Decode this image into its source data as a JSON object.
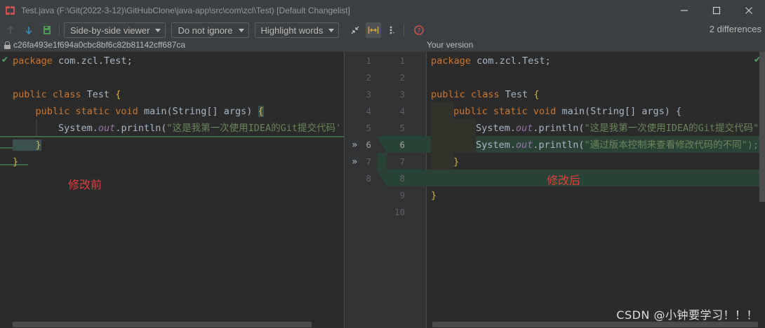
{
  "window": {
    "title": "Test.java (F:\\Git(2022-3-12)\\GitHubClone\\java-app\\src\\com\\zcl\\Test) [Default Changelist]",
    "minimize_icon": "minimize-icon",
    "maximize_icon": "maximize-icon",
    "close_icon": "close-icon"
  },
  "toolbar": {
    "viewer_mode": "Side-by-side viewer",
    "whitespace_mode": "Do not ignore",
    "highlight_mode": "Highlight words",
    "differences": "2 differences"
  },
  "header": {
    "left_revision": "c26fa493e1f694a0cbc8bf6c82b81142cff687ca",
    "right_label": "Your version"
  },
  "left_editor": {
    "lines": {
      "l1_kw": "package",
      "l1_rest": " com.zcl.Test;",
      "l3_kw": "public class",
      "l3_rest": " Test ",
      "l3_brace": "{",
      "l4_indent": "    ",
      "l4_kw": "public static void",
      "l4_rest": " main(String[] args) ",
      "l4_brace": "{",
      "l5_code": "        System.",
      "l5_field": "out",
      "l5_call": ".println(",
      "l5_str": "\"这是我第一次使用IDEA的Git提交代码'",
      "l6_brace": "    }",
      "l7_brace": "}"
    },
    "annotation": "修改前"
  },
  "right_editor": {
    "lines": {
      "l1_kw": "package",
      "l1_rest": " com.zcl.Test;",
      "l3_kw": "public class",
      "l3_rest": " Test ",
      "l3_brace": "{",
      "l4_kw": "public static void",
      "l4_rest": " main(String[] args) {",
      "l5_code": "System.",
      "l5_field": "out",
      "l5_call": ".println(",
      "l5_str": "\"这是我第一次使用IDEA的Git提交代码\")",
      "l6_code": "System.",
      "l6_field": "out",
      "l6_call": ".println(",
      "l6_str": "\"通过版本控制来查看修改代码的不同\");",
      "l7_brace": "}",
      "l9_brace": "}"
    },
    "annotation": "修改后"
  },
  "gutter": {
    "left_numbers": [
      "1",
      "2",
      "3",
      "4",
      "5",
      "6",
      "7",
      "8"
    ],
    "right_numbers": [
      "1",
      "2",
      "3",
      "4",
      "5",
      "6",
      "7",
      "8",
      "9",
      "10"
    ],
    "arrow_glyph": "»"
  },
  "watermark": "CSDN @小钟要学习！！！",
  "colors": {
    "background": "#2b2b2b",
    "toolbar": "#3c3f41",
    "change_highlight": "#294436",
    "keyword": "#cc7832",
    "string": "#6a8759",
    "annotation_red": "#e23e3e"
  }
}
